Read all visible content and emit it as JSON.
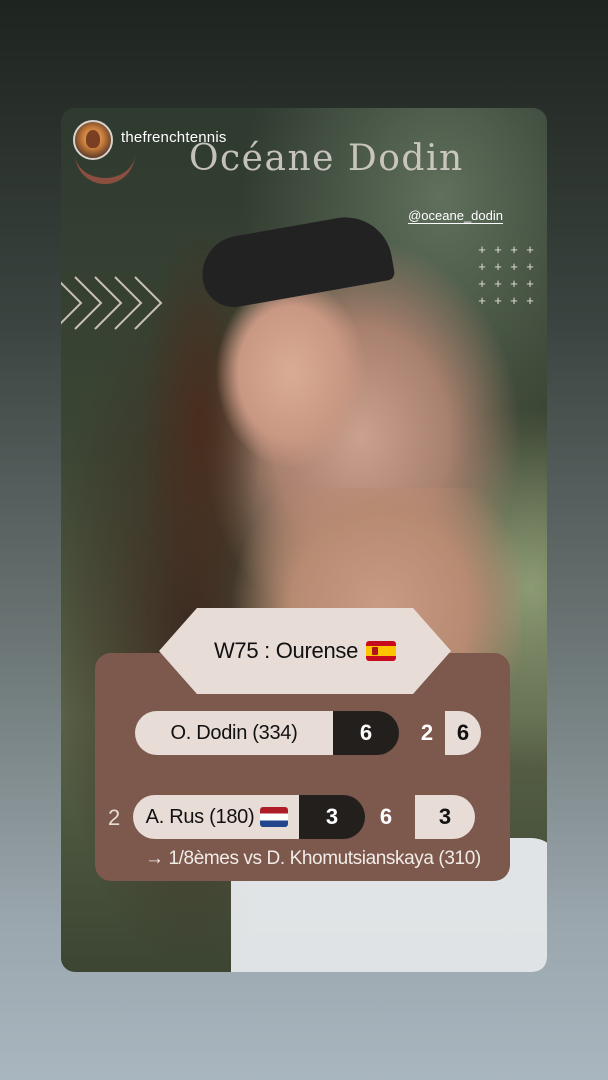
{
  "story": {
    "account_name": "thefrenchtennis",
    "title": "Océane Dodin",
    "handle": "@oceane_dodin"
  },
  "tournament": {
    "label": "W75 : Ourense",
    "flag": "spain-flag-icon"
  },
  "players": [
    {
      "name": "O. Dodin (334)",
      "seed": "",
      "flag": "",
      "sets": [
        "6",
        "2",
        "6"
      ]
    },
    {
      "name": "A. Rus (180)",
      "seed": "2",
      "flag": "netherlands-flag-icon",
      "sets": [
        "3",
        "6",
        "3"
      ]
    }
  ],
  "next_round": "→ 1/8èmes vs D. Khomutsianskaya (310)",
  "colors": {
    "card": "#7d584c",
    "pill_light": "#e7dcd6",
    "pill_dark": "#231f1d",
    "title": "#d9d4cd"
  }
}
